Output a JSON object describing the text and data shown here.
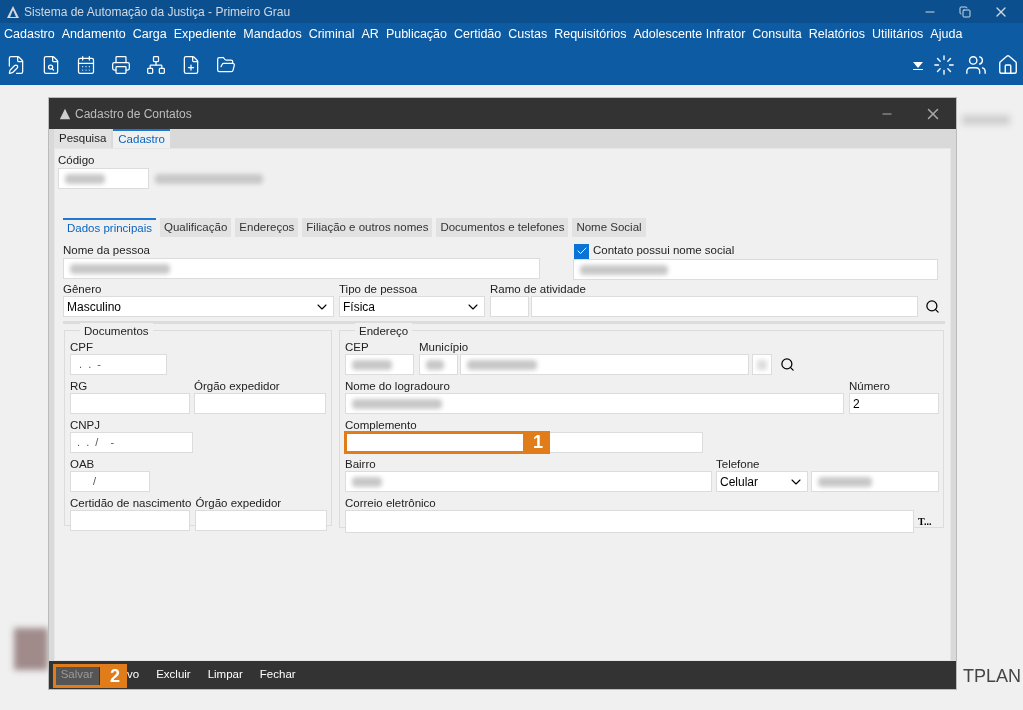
{
  "app": {
    "title": "Sistema de Automação da Justiça - Primeiro Grau",
    "menu": [
      "Cadastro",
      "Andamento",
      "Carga",
      "Expediente",
      "Mandados",
      "Criminal",
      "AR",
      "Publicação",
      "Certidão",
      "Custas",
      "Requisitórios",
      "Adolescente Infrator",
      "Consulta",
      "Relatórios",
      "Utilitários",
      "Ajuda"
    ],
    "background_logo_text": "TPLAN"
  },
  "dialog": {
    "title": "Cadastro de Contatos",
    "tabs": [
      {
        "label": "Pesquisa",
        "selected": false
      },
      {
        "label": "Cadastro",
        "selected": true
      }
    ],
    "codigo_label": "Código",
    "section_tabs": [
      {
        "label": "Dados principais",
        "selected": true
      },
      {
        "label": "Qualificação",
        "selected": false
      },
      {
        "label": "Endereços",
        "selected": false
      },
      {
        "label": "Filiação e outros nomes",
        "selected": false
      },
      {
        "label": "Documentos e telefones",
        "selected": false
      },
      {
        "label": "Nome Social",
        "selected": false
      }
    ],
    "nome_da_pessoa_label": "Nome da pessoa",
    "nome_social": {
      "label": "Contato possui nome social",
      "checked": true
    },
    "genero": {
      "label": "Gênero",
      "value": "Masculino"
    },
    "tipo_de_pessoa": {
      "label": "Tipo de pessoa",
      "value": "Física"
    },
    "ramo_de_atividade_label": "Ramo de atividade",
    "documentos": {
      "title": "Documentos",
      "cpf_label": "CPF",
      "cpf_value": ".  .  -",
      "rg_label": "RG",
      "orgao_label": "Órgão expedidor",
      "cnpj_label": "CNPJ",
      "cnpj_value": ".  .  /    -",
      "oab_label": "OAB",
      "oab_value": "/",
      "certidao_label": "Certidão de nascimento",
      "certidao_orgao_label": "Órgão expedidor"
    },
    "endereco": {
      "title": "Endereço",
      "cep_label": "CEP",
      "municipio_label": "Município",
      "logradouro_label": "Nome do logradouro",
      "numero_label": "Número",
      "numero_value": "2",
      "complemento_label": "Complemento",
      "bairro_label": "Bairro",
      "telefone_label": "Telefone",
      "telefone_type": "Celular",
      "email_label": "Correio eletrônico",
      "email_button": "T..."
    },
    "callouts": [
      "1",
      "2"
    ],
    "footer_buttons": [
      {
        "label": "Salvar",
        "disabled": true
      },
      {
        "label": "vo",
        "disabled": false
      },
      {
        "label": "Excluir",
        "disabled": false
      },
      {
        "label": "Limpar",
        "disabled": false
      },
      {
        "label": "Fechar",
        "disabled": false
      }
    ]
  }
}
